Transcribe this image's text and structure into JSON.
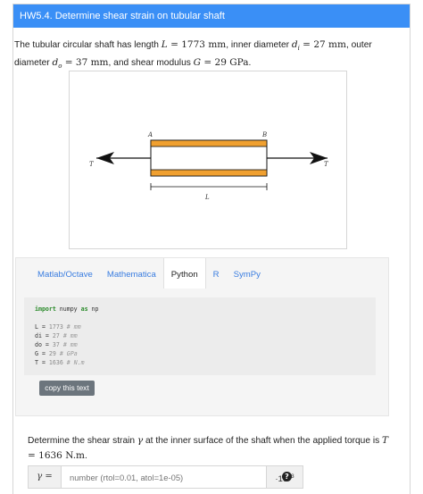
{
  "header": {
    "title": "HW5.4. Determine shear strain on tubular shaft"
  },
  "problem": {
    "text_1": "The tubular circular shaft has length ",
    "L_sym": "L",
    "L_val": " = 1773 mm",
    "text_2": ", inner diameter ",
    "di_sym": "d",
    "di_sub": "i",
    "di_val": " = 27 mm",
    "text_3": ", outer diameter ",
    "do_sym": "d",
    "do_sub": "o",
    "do_val": " = 37 mm",
    "text_4": ", and shear modulus ",
    "G_sym": "G",
    "G_val": " = 29 GPa",
    "text_5": "."
  },
  "figure": {
    "label_A": "A",
    "label_B": "B",
    "label_T_left": "T",
    "label_T_right": "T",
    "label_L": "L",
    "shaft_color": "#f0a030",
    "arrow_color": "#111111"
  },
  "tabs": [
    "Matlab/Octave",
    "Mathematica",
    "Python",
    "R",
    "SymPy"
  ],
  "active_tab": "Python",
  "code": {
    "import_kw": "import",
    "import_mod": " numpy ",
    "as_kw": "as",
    "alias": " np",
    "lines": [
      {
        "name": "L",
        "value": "1773",
        "comment": "# mm"
      },
      {
        "name": "di",
        "value": "27",
        "comment": "# mm"
      },
      {
        "name": "do",
        "value": "37",
        "comment": "# mm"
      },
      {
        "name": "G",
        "value": "29",
        "comment": "# GPa"
      },
      {
        "name": "T",
        "value": "1636",
        "comment": "# N.m"
      }
    ]
  },
  "copy_button": "copy this text",
  "question": {
    "text_1": "Determine the shear strain ",
    "gamma": "γ",
    "text_2": " at the inner surface of the shaft when the applied torque is ",
    "T_sym": "T",
    "T_val": " = 1636 N.m",
    "text_3": "."
  },
  "answer": {
    "label": "γ =",
    "placeholder": "number (rtol=0.01, atol=1e-05)",
    "unit_base": "·10",
    "unit_exp": "−3"
  },
  "help_icon": "?"
}
